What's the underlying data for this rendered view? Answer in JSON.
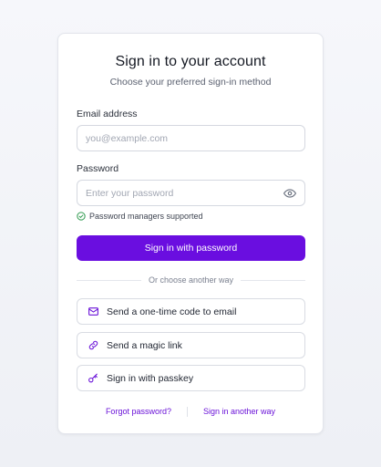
{
  "header": {
    "title": "Sign in to your account",
    "subtitle": "Choose your preferred sign-in method"
  },
  "email": {
    "label": "Email address",
    "value": "",
    "placeholder": "you@example.com"
  },
  "password": {
    "label": "Password",
    "value": "",
    "placeholder": "Enter your password",
    "toggle_icon": "eye-icon",
    "hint": "Password managers supported",
    "hint_icon": "check-circle-icon"
  },
  "actions": {
    "primary_label": "Sign in with password",
    "divider_text": "Or choose another way",
    "alternatives": [
      {
        "label": "Send a one-time code to email",
        "icon": "mail-icon"
      },
      {
        "label": "Send a magic link",
        "icon": "link-icon"
      },
      {
        "label": "Sign in with passkey",
        "icon": "key-icon"
      }
    ]
  },
  "footer": {
    "forgot_label": "Forgot password?",
    "another_way_label": "Sign in another way"
  },
  "colors": {
    "accent": "#6a0ee0",
    "link": "#6a12d8",
    "success": "#2e9a4e",
    "border": "#d5d8e0"
  }
}
